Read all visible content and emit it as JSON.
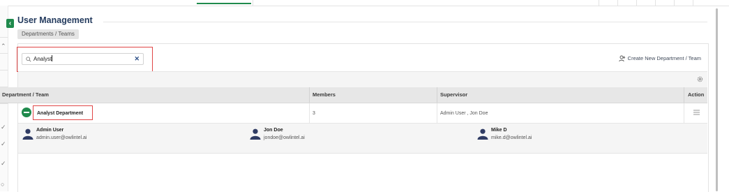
{
  "page": {
    "title": "User Management",
    "breadcrumb": "Departments / Teams"
  },
  "search": {
    "value": "Analyst"
  },
  "toolbar": {
    "create_label": "Create New Department / Team"
  },
  "table": {
    "headers": {
      "department": "Department / Team",
      "members": "Members",
      "supervisor": "Supervisor",
      "action": "Action"
    },
    "rows": [
      {
        "department": "Analyst Department",
        "members": "3",
        "supervisor": "Admin User , Jon Doe"
      }
    ]
  },
  "members": [
    {
      "name": "Admin User",
      "email": "admin.user@owlintel.ai"
    },
    {
      "name": "Jon Doe",
      "email": "jondoe@owlintel.ai"
    },
    {
      "name": "Mike D",
      "email": "mike.d@owlintel.ai"
    }
  ],
  "colors": {
    "accent": "#1f8a4c",
    "highlight": "#e04646",
    "title": "#243b5e",
    "avatar": "#2f3b63"
  },
  "icons": [
    "search-icon",
    "clear-icon",
    "add-user-icon",
    "gear-icon",
    "minus-icon",
    "menu-icon",
    "avatar-icon",
    "chevron-left-icon"
  ]
}
